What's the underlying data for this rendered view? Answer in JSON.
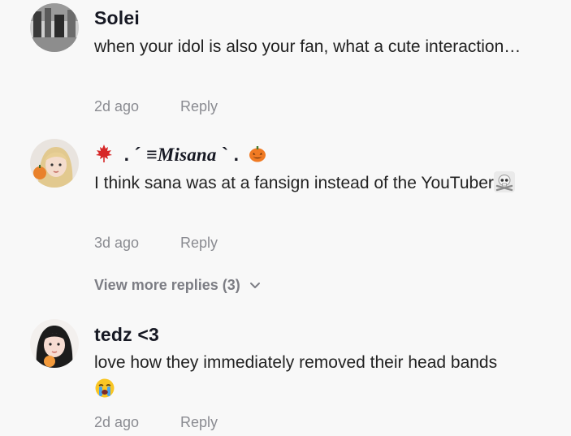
{
  "comments": [
    {
      "username": "Solei",
      "text": "when your idol is also your fan, what a cute interaction…",
      "time": "2d ago",
      "reply_label": "Reply"
    },
    {
      "username_prefix": ". ´ ≡",
      "username_fancy": "Misana",
      "username_suffix": "` .",
      "text": "I think sana was at a fansign instead of the YouTuber",
      "time": "3d ago",
      "reply_label": "Reply",
      "view_more_label": "View more replies (3)"
    },
    {
      "username": "tedz <3",
      "text": "love how they immediately removed their head bands",
      "time": "2d ago",
      "reply_label": "Reply"
    }
  ],
  "icons": {
    "username_emoji_left": "maple-leaf-icon",
    "username_emoji_right": "jack-o-lantern-icon",
    "comment2_emoji": "skull-crossbones-icon",
    "comment3_emoji": "crying-face-icon",
    "view_more": "chevron-down-icon"
  },
  "colors": {
    "background": "#f8f8f8",
    "username": "#161823",
    "meta": "#8a8b91"
  }
}
